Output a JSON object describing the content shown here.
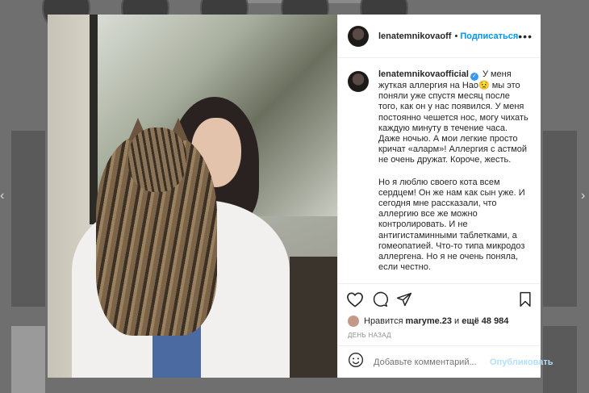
{
  "post": {
    "username": "lenatemnikovaofficial",
    "header_username": "lenatemnikovaoffic",
    "separator": "•",
    "follow_label": "Подписаться",
    "more_label": "•••",
    "caption_p1": "У меня жуткая аллергия на Нао😟 мы это поняли уже спустя месяц после того, как он у нас появился. У меня постоянно чешется нос, могу чихать каждую минуту в течение часа. Даже ночью. А мои легкие просто кричат «аларм»! Аллергия с астмой не очень дружат. Короче, жесть.",
    "caption_p2": "Но я люблю своего кота всем сердцем! Он же нам как сын уже. И сегодня мне рассказали, что аллергию все же можно контролировать. И не антигистаминными таблетками, а гомеопатией. Что-то типа микродоз аллергена. Но я не очень поняла, если честно.",
    "likes_prefix": "Нравится",
    "liked_by": "maryme.23",
    "likes_and": "и",
    "likes_more": "ещё 48 984",
    "time_ago": "ДЕНЬ НАЗАД",
    "comment_placeholder": "Добавьте комментарий...",
    "publish_label": "Опубликовать"
  },
  "icons": [
    "heart-icon",
    "comment-icon",
    "share-icon",
    "bookmark-icon",
    "emoji-icon",
    "verified-icon",
    "arrow-left-icon",
    "arrow-right-icon"
  ],
  "nav": {
    "prev": "‹",
    "next": "›"
  }
}
